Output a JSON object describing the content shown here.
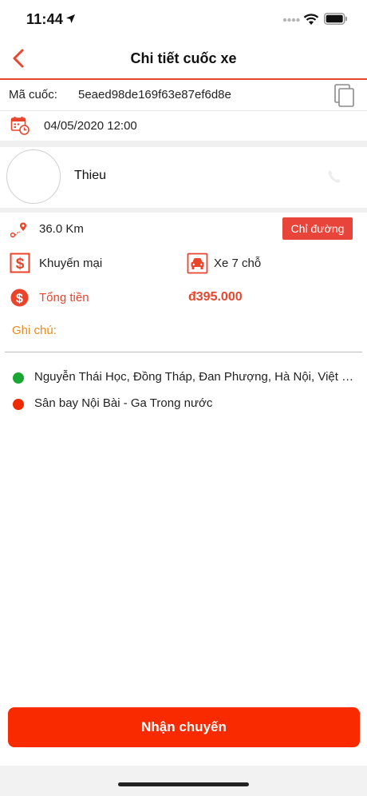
{
  "status_bar": {
    "time": "11:44"
  },
  "header": {
    "title": "Chi tiết cuốc xe"
  },
  "ride": {
    "code_label": "Mã cuốc:",
    "code_value": "5eaed98de169f63e87ef6d8e",
    "datetime": "04/05/2020 12:00"
  },
  "customer": {
    "name": "Thieu"
  },
  "details": {
    "distance": "36.0 Km",
    "directions_button": "Chỉ đường",
    "promotion": "Khuyến mại",
    "vehicle_type": "Xe 7 chỗ",
    "total_label": "Tổng tiền",
    "total_value": "đ395.000",
    "note_label": "Ghi chú:"
  },
  "route": {
    "pickup": "Nguyễn Thái Học, Đồng Tháp, Đan Phượng, Hà Nội, Việt Nam",
    "dropoff": "Sân bay Nội Bài - Ga Trong nước"
  },
  "actions": {
    "accept": "Nhận chuyến"
  },
  "colors": {
    "accent": "#e8452c",
    "accept_button": "#fa2a00",
    "note": "#e98a1e",
    "pickup_dot": "#1aa632",
    "dropoff_dot": "#f02a00"
  },
  "icons": [
    "location-arrow-icon",
    "signal-dots-icon",
    "wifi-icon",
    "battery-icon",
    "back-chevron-icon",
    "copy-icon",
    "calendar-clock-icon",
    "phone-icon",
    "route-pin-icon",
    "dollar-box-icon",
    "car-icon",
    "coin-icon"
  ]
}
